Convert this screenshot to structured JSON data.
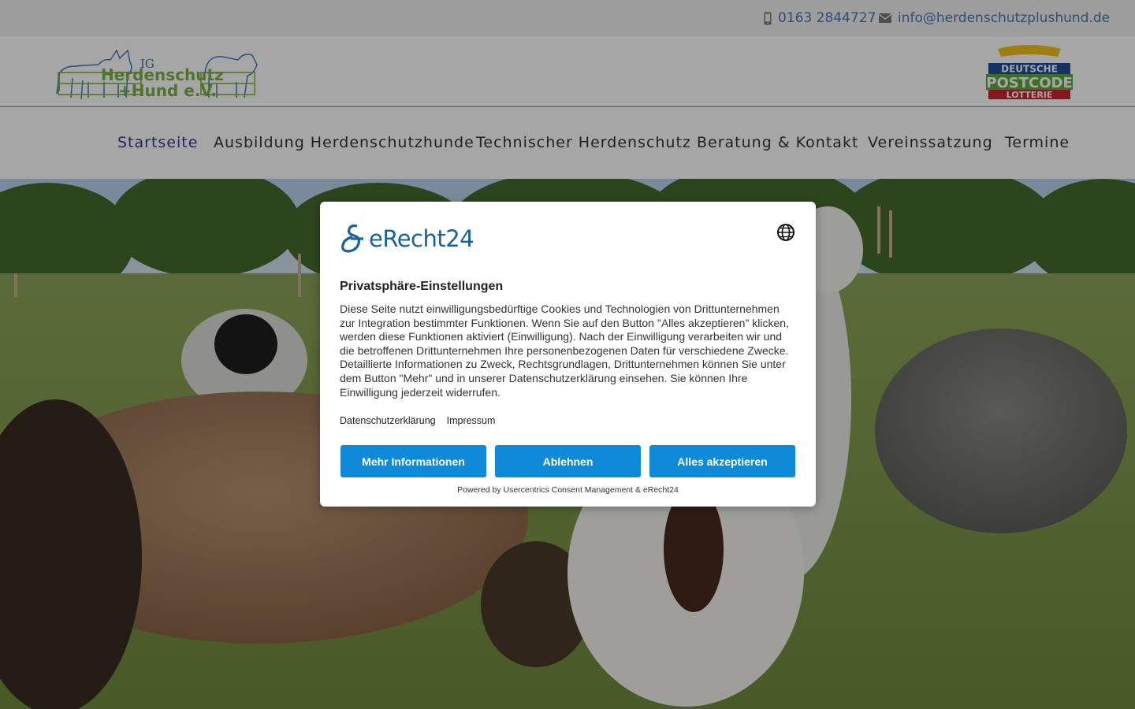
{
  "topbar": {
    "phone_icon": "mobile-phone-icon",
    "phone": "0163 2844727",
    "email_icon": "envelope-icon",
    "email": "info@herdenschutzplushund.de"
  },
  "header": {
    "logo": {
      "line1": "IG",
      "line2": "Herdenschutz",
      "line3": "+Hund e.V."
    },
    "sponsor": {
      "line1": "DEUTSCHE",
      "line2": "POSTCODE",
      "line3": "LOTTERIE"
    }
  },
  "nav": {
    "items": [
      {
        "label": "Startseite",
        "active": true
      },
      {
        "label": "Ausbildung Herdenschutzhunde"
      },
      {
        "label": "Technischer Herdenschutz"
      },
      {
        "label": "Beratung & Kontakt"
      },
      {
        "label": "Vereinssatzung"
      },
      {
        "label": "Termine"
      }
    ],
    "active_color": "#2f3d8f"
  },
  "consent": {
    "brand": "eRecht24",
    "title": "Privatsphäre-Einstellungen",
    "description": "Diese Seite nutzt einwilligungsbedürftige Cookies und Technologien von Drittunternehmen zur Integration bestimmter Funktionen. Wenn Sie auf den Button \"Alles akzeptieren\" klicken, werden diese Funktionen aktiviert (Einwilligung). Nach der Einwilligung verarbeiten wir und die betroffenen Drittunternehmen Ihre personenbezogenen Daten für verschiedene Zwecke. Detaillierte Informationen zu Zweck, Rechtsgrundlagen, Drittunternehmen können Sie unter dem Button \"Mehr\" und in unserer Datenschutzerklärung einsehen. Sie können Ihre Einwilligung jederzeit widerrufen.",
    "links": {
      "privacy": "Datenschutzerklärung",
      "imprint": "Impressum"
    },
    "buttons": {
      "more": "Mehr Informationen",
      "decline": "Ablehnen",
      "accept": "Alles akzeptieren"
    },
    "powered_by": "Powered by Usercentrics Consent Management & eRecht24",
    "accent": "#0f8ad8"
  }
}
